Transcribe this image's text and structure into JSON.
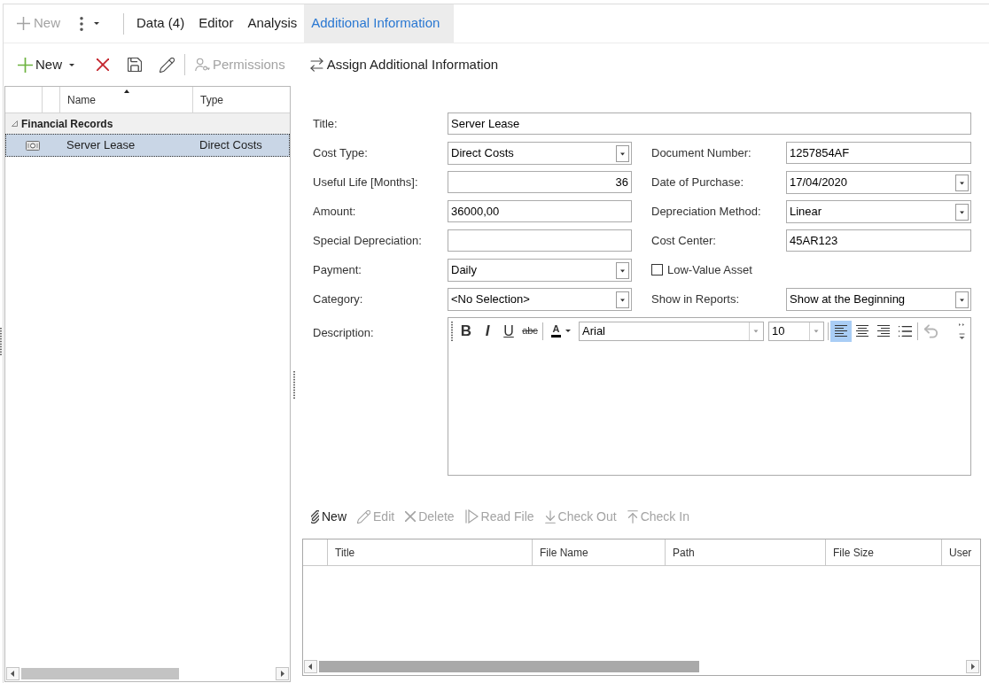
{
  "top_bar": {
    "new_button": {
      "label": "New",
      "disabled": true
    },
    "tabs": [
      {
        "label": "Data (4)",
        "selected": false
      },
      {
        "label": "Editor",
        "selected": false
      },
      {
        "label": "Analysis",
        "selected": false
      },
      {
        "label": "Additional Information",
        "selected": true
      }
    ]
  },
  "toolbar": [
    {
      "kind": "new",
      "label": "New",
      "disabled": false
    },
    {
      "kind": "delete",
      "disabled": false
    },
    {
      "kind": "save",
      "disabled": false
    },
    {
      "kind": "edit",
      "disabled": false
    },
    {
      "kind": "separator"
    },
    {
      "kind": "permissions",
      "label": "Permissions",
      "disabled": true
    },
    {
      "kind": "assign",
      "label": "Assign Additional Information",
      "disabled": false
    }
  ],
  "records": {
    "columns": [
      {
        "label": "Name",
        "sorted": true
      },
      {
        "label": "Type",
        "sorted": false
      }
    ],
    "groups": [
      {
        "label": "Financial Records",
        "expanded": true,
        "rows": [
          {
            "name": "Server Lease",
            "type": "Direct Costs",
            "selected": true
          }
        ]
      }
    ]
  },
  "form": {
    "title": {
      "label": "Title:",
      "kind": "text",
      "value": "Server Lease"
    },
    "rows": [
      {
        "left": {
          "label": "Cost Type:",
          "kind": "dropdown",
          "value": "Direct Costs"
        },
        "right": {
          "label": "Document Number:",
          "kind": "text",
          "value": "1257854AF"
        }
      },
      {
        "left": {
          "label": "Useful Life [Months]:",
          "kind": "number",
          "value": "36"
        },
        "right": {
          "label": "Date of Purchase:",
          "kind": "date",
          "value": "17/04/2020"
        }
      },
      {
        "left": {
          "label": "Amount:",
          "kind": "text",
          "value": "36000,00"
        },
        "right": {
          "label": "Depreciation Method:",
          "kind": "dropdown",
          "value": "Linear"
        }
      },
      {
        "left": {
          "label": "Special Depreciation:",
          "kind": "text"
        },
        "right": {
          "label": "Cost Center:",
          "kind": "text",
          "value": "45AR123"
        }
      },
      {
        "left": {
          "label": "Payment:",
          "kind": "dropdown",
          "value": "Daily"
        },
        "right": {
          "label": "Low-Value Asset",
          "kind": "checkbox",
          "checked": false
        }
      },
      {
        "left": {
          "label": "Category:",
          "kind": "dropdown",
          "value": "<No Selection>"
        },
        "right": {
          "label": "Show in Reports:",
          "kind": "dropdown",
          "value": "Show at the Beginning"
        }
      }
    ],
    "description": {
      "label": "Description:",
      "editor": {
        "format_buttons": [
          {
            "kind": "bold",
            "glyph": "B"
          },
          {
            "kind": "italic",
            "glyph": "I"
          },
          {
            "kind": "underline",
            "glyph": "U"
          },
          {
            "kind": "strikethrough",
            "glyph": "abc"
          }
        ],
        "font_color": {
          "glyph": "A"
        },
        "font": "Arial",
        "size": "10",
        "alignment": [
          {
            "kind": "left",
            "selected": true
          },
          {
            "kind": "center",
            "selected": false
          },
          {
            "kind": "right",
            "selected": false
          }
        ],
        "undo": {
          "disabled": true
        }
      }
    }
  },
  "attachments": {
    "toolbar": [
      {
        "kind": "new",
        "label": "New",
        "disabled": false
      },
      {
        "kind": "edit",
        "label": "Edit",
        "disabled": true
      },
      {
        "kind": "delete",
        "label": "Delete",
        "disabled": true
      },
      {
        "kind": "read",
        "label": "Read File",
        "disabled": true
      },
      {
        "kind": "check_out",
        "label": "Check Out",
        "disabled": true
      },
      {
        "kind": "check_in",
        "label": "Check In",
        "disabled": true
      }
    ],
    "columns": [
      "Title",
      "File Name",
      "Path",
      "File Size",
      "User"
    ]
  }
}
